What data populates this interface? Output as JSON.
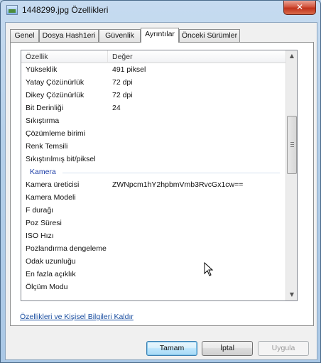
{
  "window": {
    "title": "1448299.jpg Özellikleri",
    "close_label": "✕"
  },
  "tabs": [
    {
      "label": "Genel"
    },
    {
      "label": "Dosya Hash1eri"
    },
    {
      "label": "Güvenlik"
    },
    {
      "label": "Ayrıntılar",
      "active": true
    },
    {
      "label": "Önceki Sürümler"
    }
  ],
  "list": {
    "header": {
      "property": "Özellik",
      "value": "Değer"
    },
    "rows": [
      {
        "key": "Yükseklik",
        "value": "491 piksel"
      },
      {
        "key": "Yatay Çözünürlük",
        "value": "72 dpi"
      },
      {
        "key": "Dikey Çözünürlük",
        "value": "72 dpi"
      },
      {
        "key": "Bit Derinliği",
        "value": "24"
      },
      {
        "key": "Sıkıştırma",
        "value": ""
      },
      {
        "key": "Çözümleme birimi",
        "value": ""
      },
      {
        "key": "Renk Temsili",
        "value": ""
      },
      {
        "key": "Sıkıştırılmış bit/piksel",
        "value": ""
      },
      {
        "group": "Kamera"
      },
      {
        "key": "Kamera üreticisi",
        "value": "ZWNpcm1hY2hpbmVmb3RvcGx1cw=="
      },
      {
        "key": "Kamera Modeli",
        "value": ""
      },
      {
        "key": "F durağı",
        "value": ""
      },
      {
        "key": "Poz Süresi",
        "value": ""
      },
      {
        "key": "ISO Hızı",
        "value": ""
      },
      {
        "key": "Pozlandırma dengeleme",
        "value": ""
      },
      {
        "key": "Odak uzunluğu",
        "value": ""
      },
      {
        "key": "En fazla açıklık",
        "value": ""
      },
      {
        "key": "Ölçüm Modu",
        "value": ""
      }
    ]
  },
  "remove_link": "Özellikleri ve Kişisel Bilgileri Kaldır",
  "buttons": {
    "ok": "Tamam",
    "cancel": "İptal",
    "apply": "Uygula"
  },
  "icons": {
    "title_icon": "image-file-icon",
    "scroll_up": "up-arrow-icon",
    "scroll_down": "down-arrow-icon",
    "cursor": "mouse-cursor-icon"
  }
}
